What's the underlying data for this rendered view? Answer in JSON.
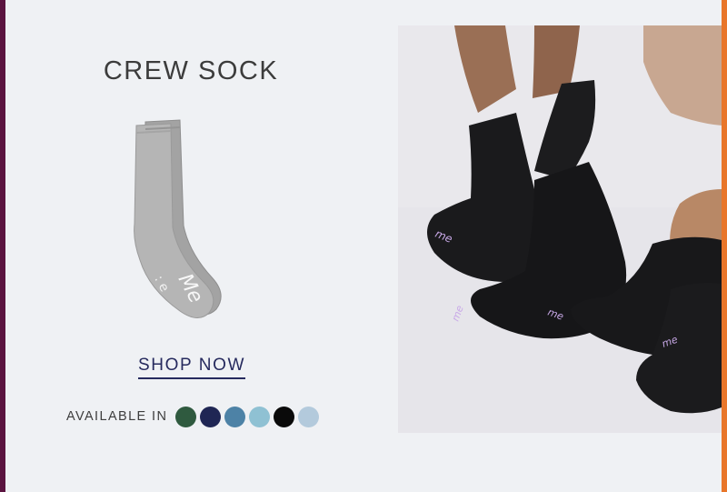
{
  "product": {
    "title": "CREW SOCK",
    "image_icon": "gray-crew-sock-image"
  },
  "cta": {
    "shop_now_label": "SHOP NOW"
  },
  "colors": {
    "label": "AVAILABLE IN",
    "swatches": [
      {
        "name": "forest-green",
        "hex": "#2f5a3f"
      },
      {
        "name": "navy",
        "hex": "#1f2654"
      },
      {
        "name": "steel-blue",
        "hex": "#4d82a6"
      },
      {
        "name": "light-teal",
        "hex": "#8fc1d3"
      },
      {
        "name": "black",
        "hex": "#0a0a0a"
      },
      {
        "name": "powder-blue",
        "hex": "#b3cadc"
      }
    ]
  },
  "lifestyle_photo": {
    "icon": "black-socks-on-feet-photo",
    "sock_logo": "me"
  },
  "theme": {
    "background": "#eff1f4",
    "title_color": "#3c3c3c",
    "cta_color": "#262a5e",
    "left_edge": "#5b1440",
    "right_edge": "#e8762a"
  }
}
